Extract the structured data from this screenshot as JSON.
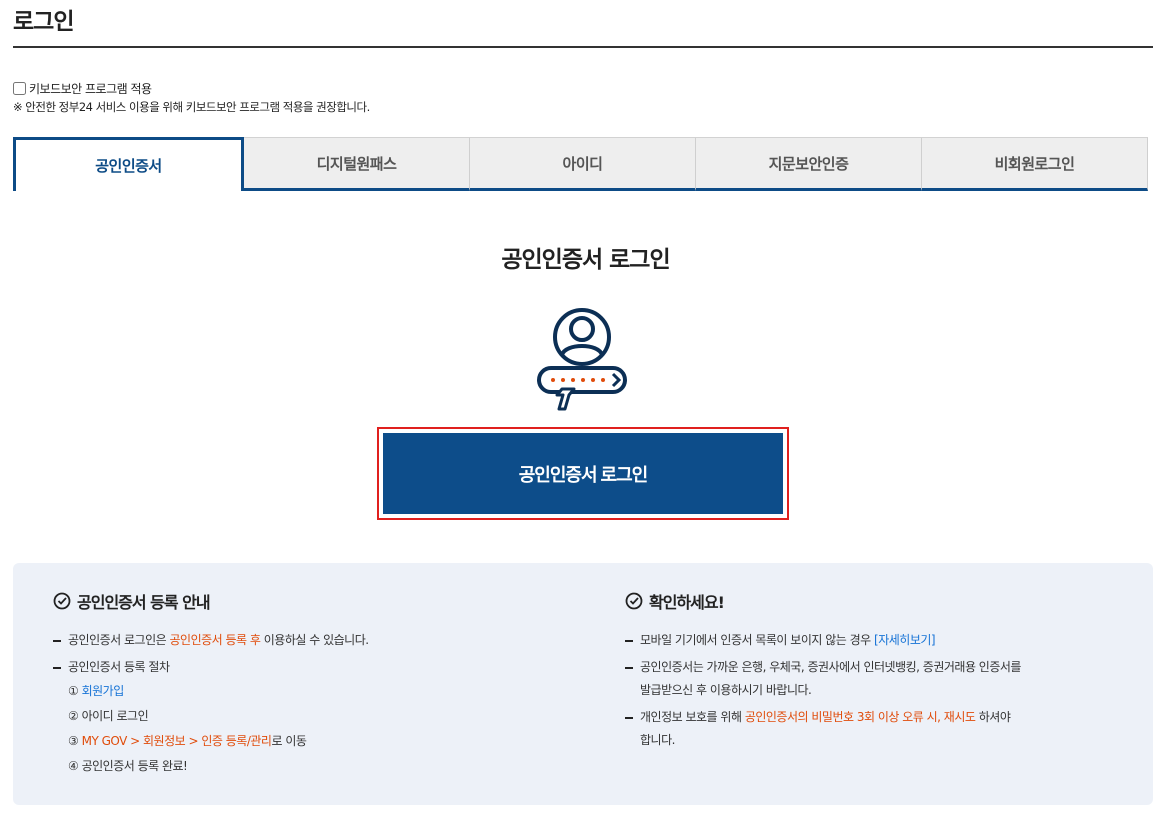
{
  "page": {
    "title": "로그인"
  },
  "keyboard": {
    "checkbox_label": "키보드보안 프로그램 적용",
    "checked": false,
    "note": "※ 안전한 정부24 서비스 이용을 위해 키보드보안 프로그램 적용을 권장합니다."
  },
  "tabs": [
    {
      "label": "공인인증서",
      "active": true
    },
    {
      "label": "디지털원패스",
      "active": false
    },
    {
      "label": "아이디",
      "active": false
    },
    {
      "label": "지문보안인증",
      "active": false
    },
    {
      "label": "비회원로그인",
      "active": false
    }
  ],
  "login": {
    "heading": "공인인증서 로그인",
    "button_label": "공인인증서 로그인",
    "icon": "certificate-user-icon"
  },
  "info_left": {
    "heading": "공인인증서 등록 안내",
    "item1_pre": "공인인증서 로그인은 ",
    "item1_highlight": "공인인증서 등록 후",
    "item1_post": " 이용하실 수 있습니다.",
    "item2_title": "공인인증서 등록 절차",
    "step1_num": "①",
    "step1_link": "회원가입",
    "step2": "② 아이디 로그인",
    "step3_num": "③",
    "step3_highlight": "MY GOV > 회원정보 > 인증 등록/관리",
    "step3_post": "로 이동",
    "step4": "④ 공인인증서 등록 완료!"
  },
  "info_right": {
    "heading": "확인하세요!",
    "item1_pre": "모바일 기기에서 인증서 목록이 보이지 않는 경우 ",
    "item1_link": "[자세히보기]",
    "item2_line1": "공인인증서는 가까운 은행, 우체국, 증권사에서 인터넷뱅킹, 증권거래용 인증서를",
    "item2_line2": "발급받으신 후 이용하시기 바랍니다.",
    "item3_pre": "개인정보 보호를 위해 ",
    "item3_highlight": "공인인증서의 비밀번호 3회 이상 오류 시, 재시도",
    "item3_post": " 하셔야",
    "item3_line2": "합니다."
  },
  "colors": {
    "brand_blue": "#0d4d8a",
    "highlight_orange": "#e04c0b",
    "link_blue": "#1673d6",
    "focus_red": "#e0201e"
  }
}
